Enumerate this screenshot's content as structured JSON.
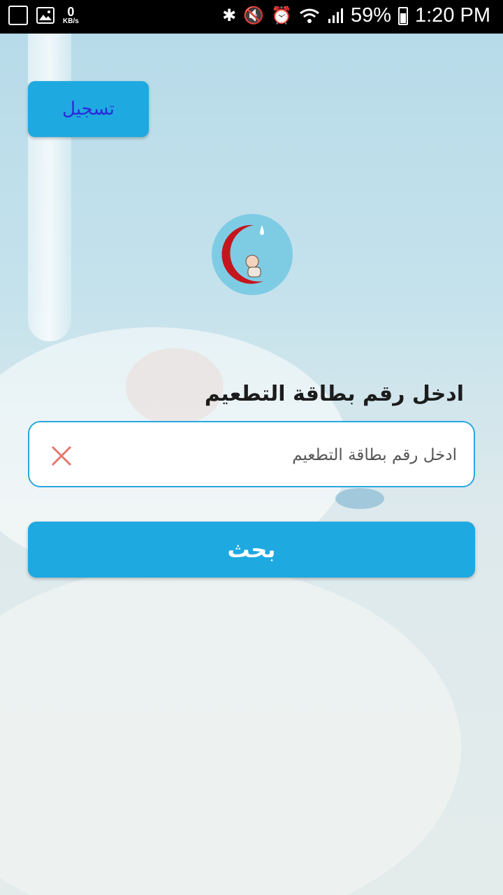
{
  "status_bar": {
    "speed_value": "0",
    "speed_unit": "KB/s",
    "battery": "59%",
    "time": "1:20 PM",
    "icons": [
      "gallery-icon",
      "image-icon",
      "bluetooth-icon",
      "mute-icon",
      "alarm-icon",
      "wifi-icon",
      "signal-icon",
      "battery-icon"
    ]
  },
  "header": {
    "register_label": "تسجيل"
  },
  "logo": {
    "icon": "red-crescent-baby-logo",
    "colors": {
      "circle": "#7ecbe4",
      "crescent": "#c4161c"
    }
  },
  "form": {
    "prompt": "ادخل رقم بطاقة التطعيم",
    "input_value": "",
    "input_placeholder": "ادخل رقم بطاقة التطعيم",
    "clear_icon": "close-icon",
    "search_label": "بحث"
  },
  "colors": {
    "accent": "#1fa9e1",
    "register_text": "#2b2bd8",
    "clear_icon": "#e8756d"
  }
}
